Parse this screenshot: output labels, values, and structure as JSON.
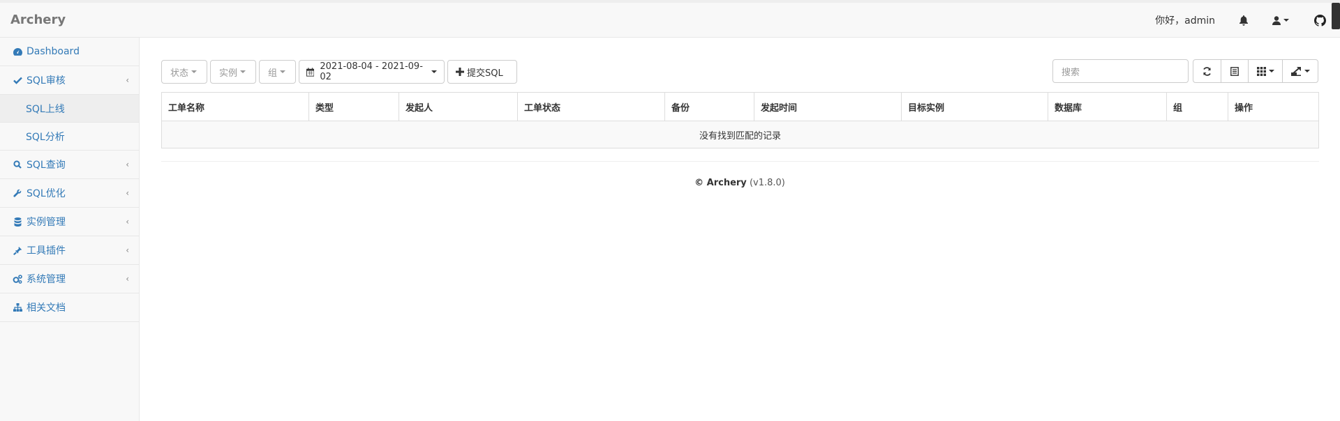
{
  "navbar": {
    "brand": "Archery",
    "greeting": "你好，admin"
  },
  "sidebar": {
    "items": [
      {
        "label": "Dashboard",
        "icon": "dashboard-icon"
      },
      {
        "label": "SQL审核",
        "icon": "check-icon"
      },
      {
        "label": "SQL上线",
        "sub": true
      },
      {
        "label": "SQL分析",
        "sub": true
      },
      {
        "label": "SQL查询",
        "icon": "search-icon"
      },
      {
        "label": "SQL优化",
        "icon": "wrench-icon"
      },
      {
        "label": "实例管理",
        "icon": "database-icon"
      },
      {
        "label": "工具插件",
        "icon": "plug-icon"
      },
      {
        "label": "系统管理",
        "icon": "cogs-icon"
      },
      {
        "label": "相关文档",
        "icon": "sitemap-icon"
      }
    ]
  },
  "toolbar": {
    "status_label": "状态",
    "instance_label": "实例",
    "group_label": "组",
    "date_range": "2021-08-04 - 2021-09-02",
    "submit_label": "提交SQL",
    "search_placeholder": "搜索"
  },
  "table": {
    "columns": [
      "工单名称",
      "类型",
      "发起人",
      "工单状态",
      "备份",
      "发起时间",
      "目标实例",
      "数据库",
      "组",
      "操作"
    ],
    "empty_text": "没有找到匹配的记录"
  },
  "footer": {
    "copyright": "© Archery",
    "version": "(v1.8.0)"
  },
  "colors": {
    "link": "#337ab7",
    "navbar_bg": "#f8f8f8",
    "border": "#dddddd"
  }
}
